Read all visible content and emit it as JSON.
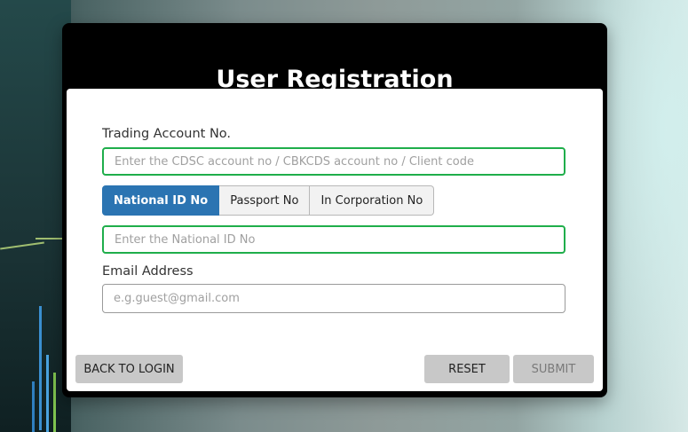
{
  "modal": {
    "title": "User Registration"
  },
  "form": {
    "trading_account": {
      "label": "Trading Account No.",
      "value": "",
      "placeholder": "Enter the CDSC account no / CBKCDS account no / Client code"
    },
    "id_tabs": [
      {
        "label": "National ID No",
        "active": true
      },
      {
        "label": "Passport No",
        "active": false
      },
      {
        "label": "In Corporation No",
        "active": false
      }
    ],
    "national_id": {
      "value": "",
      "placeholder": "Enter the National ID No"
    },
    "email": {
      "label": "Email Address",
      "value": "",
      "placeholder": "e.g.guest@gmail.com"
    }
  },
  "actions": {
    "back_label": "BACK TO LOGIN",
    "reset_label": "RESET",
    "submit_label": "SUBMIT"
  },
  "colors": {
    "header": "#000000",
    "active_tab": "#2b74b2",
    "input_focus_border": "#1fae4b",
    "button_bg": "#c8c8c8"
  }
}
